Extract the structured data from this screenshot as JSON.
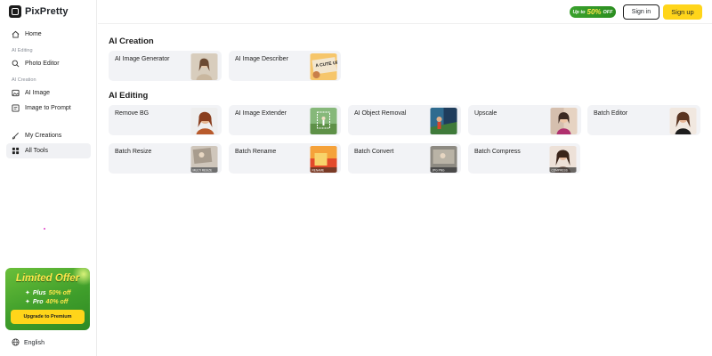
{
  "brand": {
    "name": "PixPretty"
  },
  "sidebar": {
    "home": "Home",
    "ai_editing_label": "AI Editing",
    "photo_editor": "Photo Editor",
    "ai_creation_label": "AI Creation",
    "ai_image": "AI Image",
    "image_to_prompt": "Image to Prompt",
    "my_creations": "My Creations",
    "all_tools": "All Tools",
    "language": "English"
  },
  "offer": {
    "title": "Limited Offer",
    "plus_label": "Plus",
    "plus_value": "50% off",
    "pro_label": "Pro",
    "pro_value": "40% off",
    "button": "Upgrade to Premium"
  },
  "header": {
    "promo_prefix": "Up to",
    "promo_value": "50%",
    "promo_suffix": "OFF",
    "signin": "Sign in",
    "signup": "Sign up"
  },
  "sections": {
    "ai_creation": "AI Creation",
    "ai_editing": "AI Editing"
  },
  "tools": {
    "ai_creation": [
      "AI Image Generator",
      "AI Image Describer"
    ],
    "ai_editing": [
      "Remove BG",
      "AI Image Extender",
      "AI Object Removal",
      "Upscale",
      "Batch Editor",
      "Batch Resize",
      "Batch Rename",
      "Batch Convert",
      "Batch Compress"
    ]
  },
  "thumb_text": {
    "describer": "A CUTE UP IMAGE",
    "batch_resize": "MULTI RESIZE",
    "batch_rename": "RENAME",
    "batch_convert": "JPG PNG",
    "batch_compress": "COMPRESS"
  },
  "colors": {
    "accent_yellow": "#ffd51a",
    "promo_green": "#3aa12d",
    "card_bg": "#f2f3f6"
  }
}
